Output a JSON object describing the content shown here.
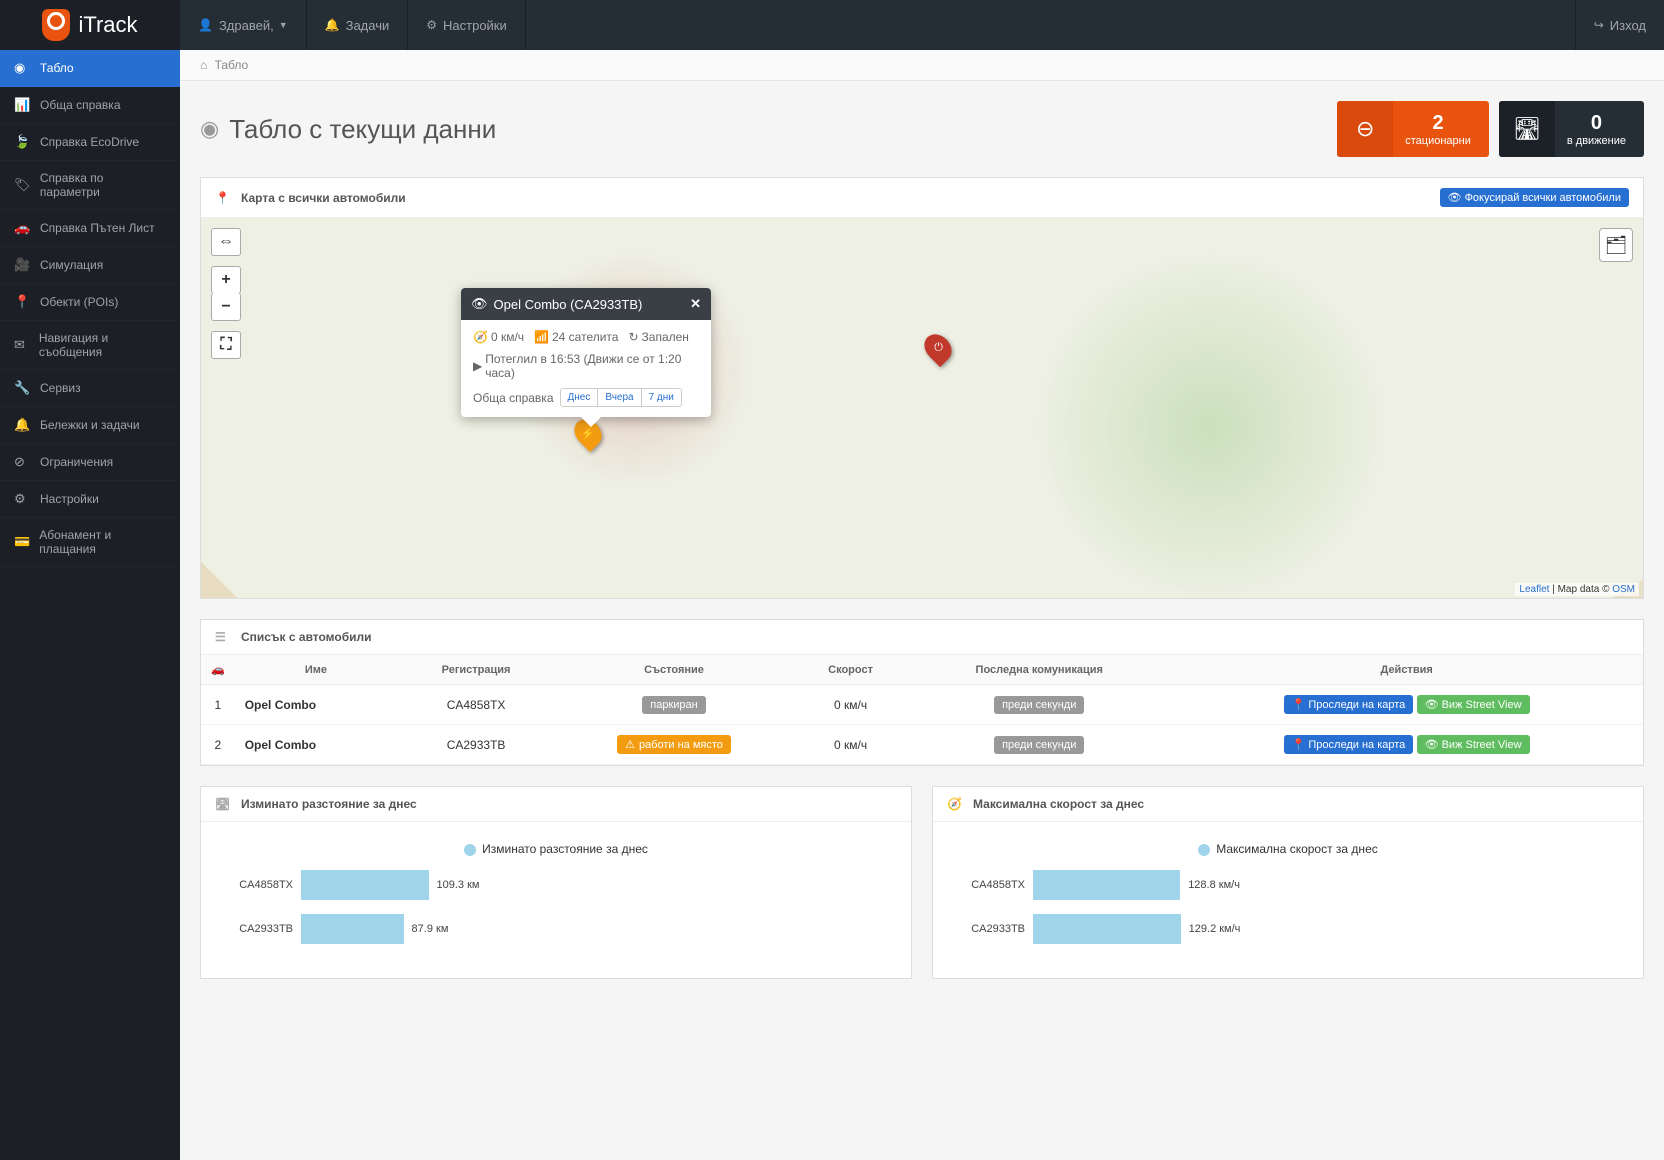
{
  "brand": "iTrack",
  "topnav": {
    "greeting": "Здравей,",
    "tasks": "Задачи",
    "settings": "Настройки",
    "logout": "Изход"
  },
  "sidebar": [
    {
      "label": "Табло",
      "active": true
    },
    {
      "label": "Обща справка"
    },
    {
      "label": "Справка EcoDrive"
    },
    {
      "label": "Справка по параметри"
    },
    {
      "label": "Справка Пътен Лист"
    },
    {
      "label": "Симулация"
    },
    {
      "label": "Обекти (POIs)"
    },
    {
      "label": "Навигация и съобщения"
    },
    {
      "label": "Сервиз"
    },
    {
      "label": "Бележки и задачи"
    },
    {
      "label": "Ограничения"
    },
    {
      "label": "Настройки"
    },
    {
      "label": "Абонамент и плащания"
    }
  ],
  "breadcrumb": "Табло",
  "page_title": "Табло с текущи данни",
  "stats": {
    "stationary": {
      "value": "2",
      "label": "стационарни"
    },
    "moving": {
      "value": "0",
      "label": "в движение"
    }
  },
  "map_panel": {
    "title": "Карта с всички автомобили",
    "focus_btn": "Фокусирай всички автомобили",
    "attrib_leaflet": "Leaflet",
    "attrib_mid": " | Map data © ",
    "attrib_osm": "OSM"
  },
  "popup": {
    "title": "Opel Combo (CA2933TB)",
    "speed": "0 км/ч",
    "sats": "24 сателита",
    "ignition": "Запален",
    "departed": "Потеглил в 16:53 (Движи се от 1:20 часа)",
    "ref_label": "Обща справка",
    "ref_today": "Днес",
    "ref_yesterday": "Вчера",
    "ref_7days": "7 дни"
  },
  "vehicles_panel": {
    "title": "Списък с автомобили",
    "cols": {
      "name": "Име",
      "reg": "Регистрация",
      "state": "Състояние",
      "speed": "Скорост",
      "lastcomm": "Последна комуникация",
      "actions": "Действия"
    },
    "btn_track": "Проследи на карта",
    "btn_street": "Виж Street View",
    "rows": [
      {
        "n": "1",
        "name": "Opel Combo",
        "reg": "CA4858TX",
        "state": "паркиран",
        "state_kind": "gray",
        "speed": "0 км/ч",
        "lastcomm": "преди секунди"
      },
      {
        "n": "2",
        "name": "Opel Combo",
        "reg": "CA2933TB",
        "state": "работи на място",
        "state_kind": "orange",
        "speed": "0 км/ч",
        "lastcomm": "преди секунди"
      }
    ]
  },
  "chart_distance": {
    "title": "Изминато разстояние за днес",
    "legend": "Изминато разстояние за днес"
  },
  "chart_speed": {
    "title": "Максимална скорост за днес",
    "legend": "Максимална скорост за днес"
  },
  "chart_data": [
    {
      "type": "bar",
      "orientation": "horizontal",
      "title": "Изминато разстояние за днес",
      "unit": "км",
      "categories": [
        "CA4858TX",
        "CA2933TB"
      ],
      "values": [
        109.3,
        87.9
      ],
      "xlim": [
        0,
        120
      ]
    },
    {
      "type": "bar",
      "orientation": "horizontal",
      "title": "Максимална скорост за днес",
      "unit": "км/ч",
      "categories": [
        "CA4858TX",
        "CA2933TB"
      ],
      "values": [
        128.8,
        129.2
      ],
      "xlim": [
        0,
        140
      ]
    }
  ]
}
